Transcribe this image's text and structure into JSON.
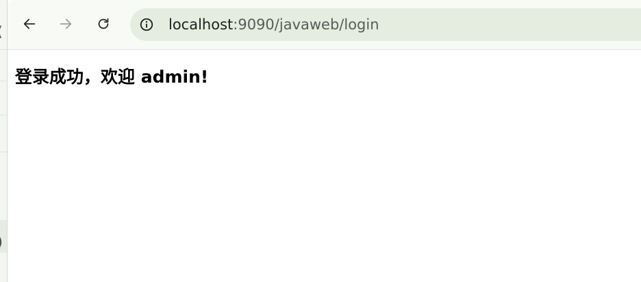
{
  "browser": {
    "url": {
      "host": "localhost",
      "path": ":9090/javaweb/login"
    },
    "icons": {
      "back": "arrow-left",
      "forward": "arrow-right",
      "reload": "reload",
      "site_info": "info-circle"
    },
    "colors": {
      "toolbar": "#f8faf6",
      "omnibox": "#e4eddf",
      "icon_active": "#2b2b2b",
      "icon_disabled": "#9aa09a"
    }
  },
  "page": {
    "message": "登录成功，欢迎 admin!"
  },
  "background_window": {
    "glyph_top": "(",
    "glyph_bottom": ")"
  }
}
